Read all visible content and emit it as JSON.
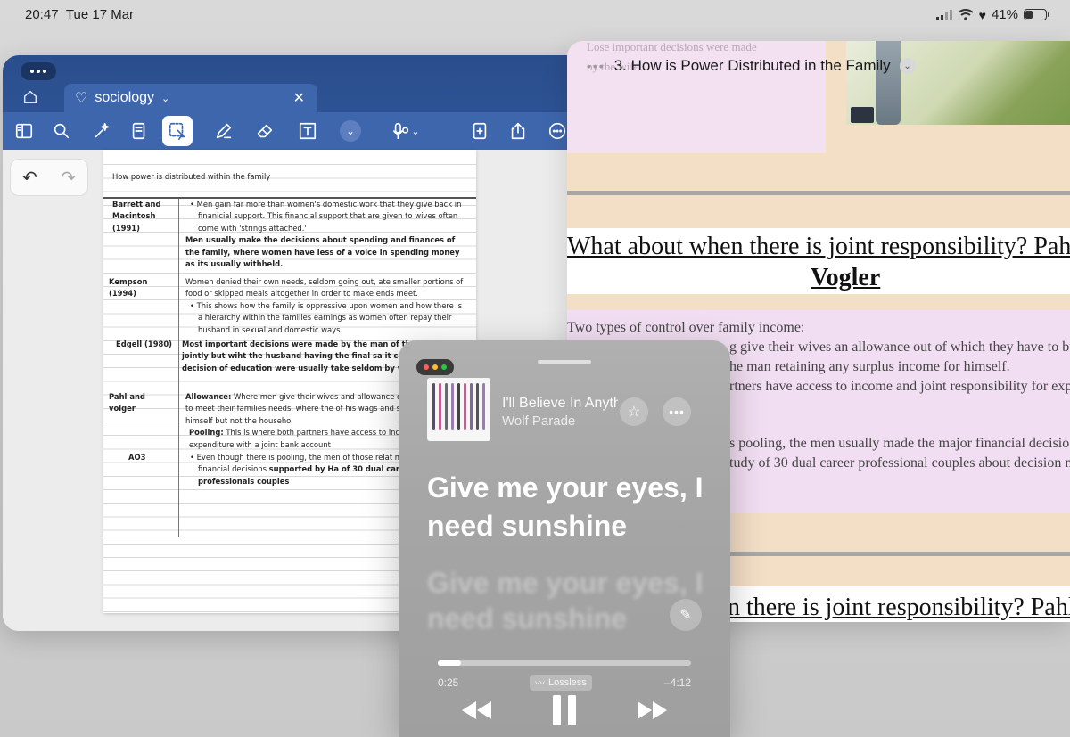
{
  "status": {
    "time": "20:47",
    "date": "Tue 17 Mar",
    "battery_percent": "41%",
    "battery_level": 0.41
  },
  "notes": {
    "tab_label": "sociology",
    "page": {
      "title": "How power is distributed within the family",
      "rows": [
        {
          "author": "Barrett and Macintosh (1991)",
          "lines": [
            {
              "text": "Men gain far more than women's domestic work that they give back in finanicial support. This financial support that are given to wives often come with 'strings attached.'",
              "style": "bullet"
            },
            {
              "text": "Men usually make the decisions about spending and finances of the family, where women have less of a voice in spending money as its usually withheld.",
              "style": "bold"
            }
          ]
        },
        {
          "author": "Kempson (1994)",
          "lines": [
            {
              "text": "Women denied their own needs, seldom going out, ate smaller portions of food or skipped meals altogether in order to make ends meet.",
              "style": "plain"
            },
            {
              "text": "This shows how the family is oppressive upon women and how there is a hierarchy within the families earnings as women often repay their husband in sexual and domestic ways.",
              "style": "bullet"
            }
          ]
        },
        {
          "author": "Edgell (1980)",
          "lines": [
            {
              "text": "Most important decisions were made by the man of the h taken jointly but wiht the husband having the final sa it came to the decision of education were usually take seldom by wife alone.",
              "style": "bold"
            }
          ]
        },
        {
          "author": "Pahl and volger",
          "lines": [
            {
              "label": "Allowance:",
              "text": " Where men give their wives and allowance o have to budget to meet their families needs, where the of his wags and splurges on himself but not the househo",
              "style": "labelled"
            },
            {
              "label": "Pooling:",
              "text": " This is where both partners have access to inc responsibility for expenditure with a joint bank account",
              "style": "labelled"
            }
          ]
        },
        {
          "author": "AO3",
          "lines": [
            {
              "text": "Even though there is pooling, the men of those relat made the major financial decisions ",
              "bold_tail": "supported by Ha of 30 dual career professionals couples",
              "style": "bullet-mixed"
            }
          ]
        }
      ]
    }
  },
  "article": {
    "title": "3. How is Power Distributed in the Family",
    "ghost_lines": [
      "Lose important decisions were made",
      "by the wife."
    ],
    "heading": "What about when there is joint responsibility? Pahl",
    "heading_bold": "Vogler",
    "paragraphs": [
      "Two types of control over family income:",
      "g give their wives an allowance out of which they have to budg",
      "he man retaining any surplus income for himself.",
      "rtners have access to income and joint responsibility for expe",
      "s pooling, the men usually made the major financial decisio",
      "tudy of 30 dual career professional couples about decision m"
    ],
    "bottom_heading": "n there is joint responsibility? Pahl"
  },
  "music": {
    "song": "I'll Believe In Anything",
    "artist": "Wolf Parade",
    "lyric_current": "Give me your eyes, I need sunshine",
    "lyric_next": "Give me your eyes, I need sunshine",
    "elapsed": "0:25",
    "remaining": "–4:12",
    "quality": "Lossless",
    "progress": 0.09
  }
}
